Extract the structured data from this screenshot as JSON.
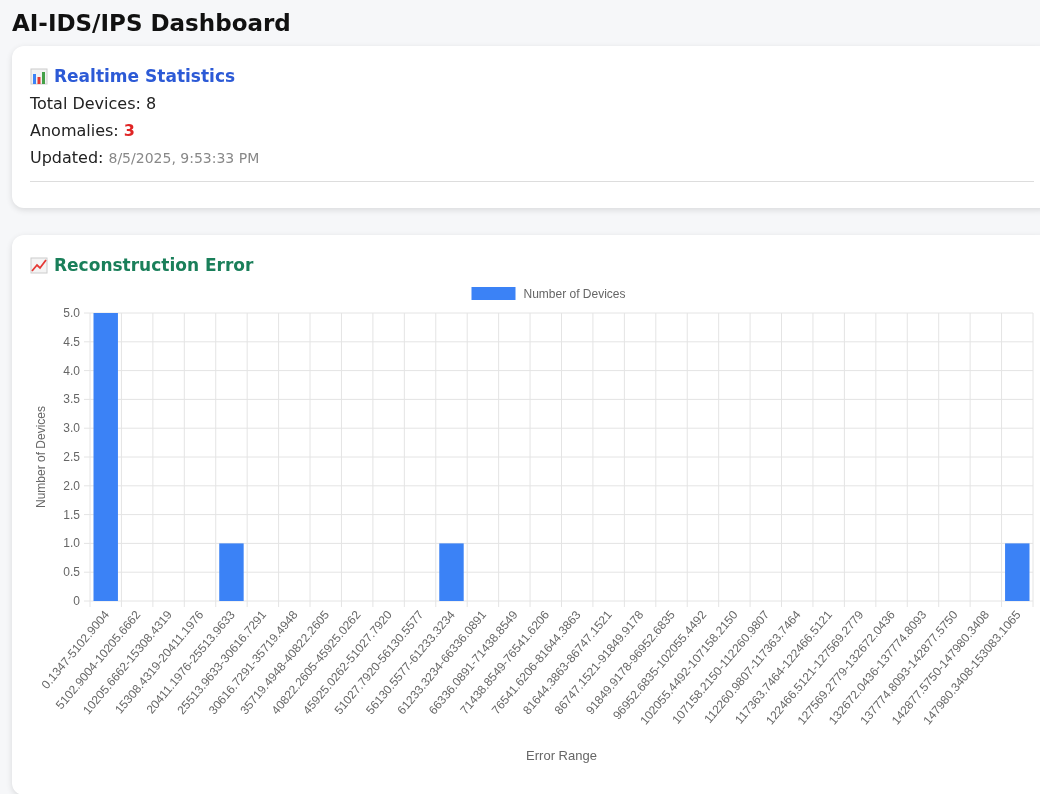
{
  "title": "AI-IDS/IPS Dashboard",
  "stats_card": {
    "title": "Realtime Statistics",
    "stats": [
      {
        "kind": "plain",
        "label": "Total Devices:",
        "value": "8"
      },
      {
        "kind": "alert",
        "label": "Anomalies:",
        "value": "3"
      },
      {
        "kind": "timestamp",
        "label": "Updated:",
        "value": "8/5/2025, 9:53:33 PM"
      }
    ]
  },
  "chart_card": {
    "title": "Reconstruction Error",
    "chart_data": {
      "type": "bar",
      "xlabel": "Error Range",
      "ylabel": "Number of Devices",
      "categories": [
        "0.1347-5102.9004",
        "5102.9004-10205.6662",
        "10205.6662-15308.4319",
        "15308.4319-20411.1976",
        "20411.1976-25513.9633",
        "25513.9633-30616.7291",
        "30616.7291-35719.4948",
        "35719.4948-40822.2605",
        "40822.2605-45925.0262",
        "45925.0262-51027.7920",
        "51027.7920-56130.5577",
        "56130.5577-61233.3234",
        "61233.3234-66336.0891",
        "66336.0891-71438.8549",
        "71438.8549-76541.6206",
        "76541.6206-81644.3863",
        "81644.3863-86747.1521",
        "86747.1521-91849.9178",
        "91849.9178-96952.6835",
        "96952.6835-102055.4492",
        "102055.4492-107158.2150",
        "107158.2150-112260.9807",
        "112260.9807-117363.7464",
        "117363.7464-122466.5121",
        "122466.5121-127569.2779",
        "127569.2779-132672.0436",
        "132672.0436-137774.8093",
        "137774.8093-142877.5750",
        "142877.5750-147980.3408",
        "147980.3408-153083.1065"
      ],
      "series": [
        {
          "name": "Number of Devices",
          "color": "#3b82f6",
          "values": [
            5,
            0,
            0,
            0,
            1,
            0,
            0,
            0,
            0,
            0,
            0,
            1,
            0,
            0,
            0,
            0,
            0,
            0,
            0,
            0,
            0,
            0,
            0,
            0,
            0,
            0,
            0,
            0,
            0,
            1
          ]
        }
      ],
      "ylim": [
        0,
        5
      ],
      "grid": true,
      "yticks": [
        {
          "value": 0,
          "label": "0"
        },
        {
          "value": 0.5,
          "label": "0.5"
        },
        {
          "value": 1,
          "label": "1.0"
        },
        {
          "value": 1.5,
          "label": "1.5"
        },
        {
          "value": 2,
          "label": "2.0"
        },
        {
          "value": 2.5,
          "label": "2.5"
        },
        {
          "value": 3,
          "label": "3.0"
        },
        {
          "value": 3.5,
          "label": "3.5"
        },
        {
          "value": 4,
          "label": "4.0"
        },
        {
          "value": 4.5,
          "label": "4.5"
        },
        {
          "value": 5,
          "label": "5.0"
        }
      ]
    }
  }
}
